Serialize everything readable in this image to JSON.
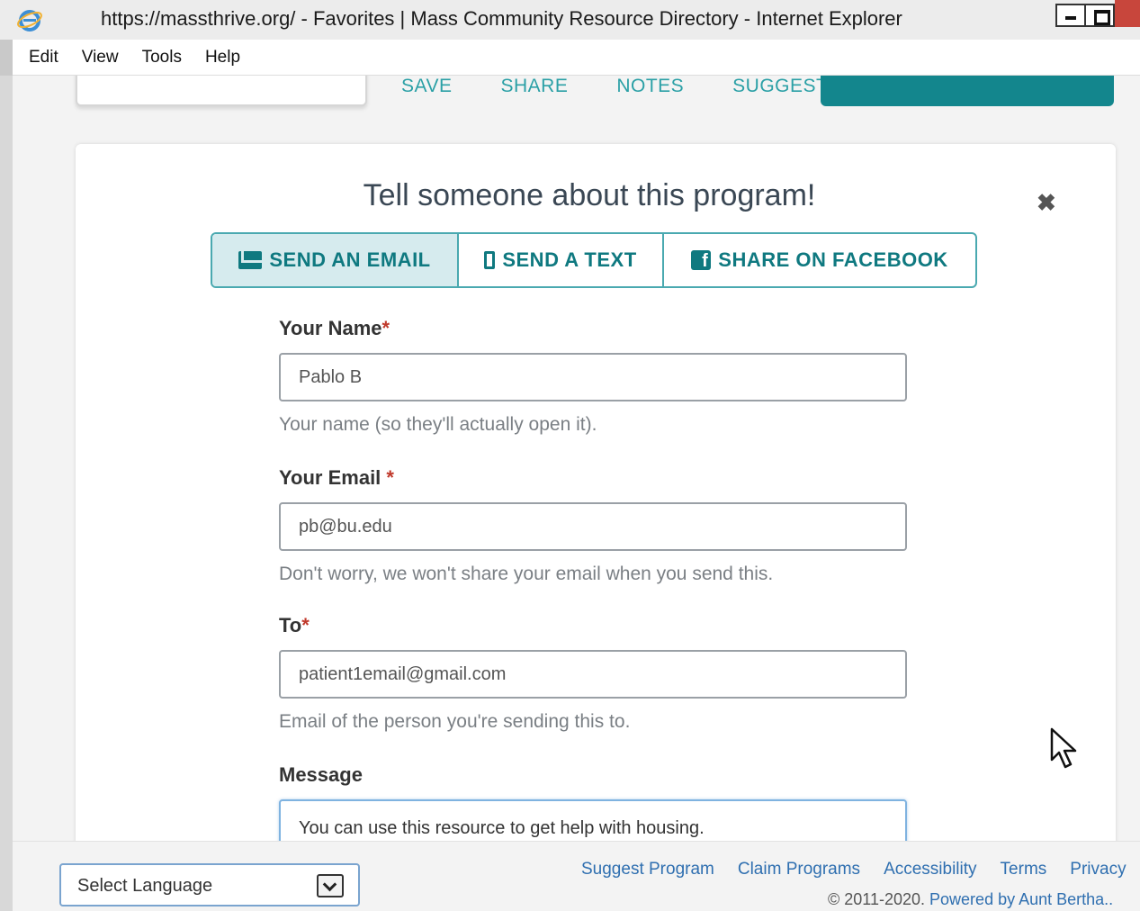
{
  "window": {
    "title": "https://massthrive.org/ - Favorites | Mass Community Resource Directory - Internet Explorer"
  },
  "menu": [
    "Edit",
    "View",
    "Tools",
    "Help"
  ],
  "toolbar": {
    "links": [
      "SAVE",
      "SHARE",
      "NOTES",
      "SUGGEST"
    ]
  },
  "modal": {
    "title": "Tell someone about this program!",
    "close_icon": "close-icon",
    "tabs": [
      {
        "label": "SEND AN EMAIL",
        "icon": "envelope-icon",
        "active": true
      },
      {
        "label": "SEND A TEXT",
        "icon": "phone-icon",
        "active": false
      },
      {
        "label": "SHARE ON FACEBOOK",
        "icon": "facebook-icon",
        "active": false
      }
    ],
    "fields": {
      "name": {
        "label": "Your Name",
        "required_mark": "*",
        "value": "Pablo B",
        "help": "Your name (so they'll actually open it)."
      },
      "email": {
        "label": "Your Email",
        "required_mark": "*",
        "value": "pb@bu.edu",
        "help": "Don't worry, we won't share your email when you send this."
      },
      "to": {
        "label": "To",
        "required_mark": "*",
        "value": "patient1email@gmail.com",
        "help": "Email of the person you're sending this to."
      },
      "message": {
        "label": "Message",
        "value": "You can use this resource to get help with housing."
      }
    }
  },
  "footer": {
    "language_select": "Select Language",
    "links": [
      "Suggest Program",
      "Claim Programs",
      "Accessibility",
      "Terms",
      "Privacy"
    ],
    "copyright_prefix": "© 2011-2020.",
    "powered_by": "Powered by Aunt Bertha.."
  },
  "colors": {
    "accent_teal": "#13868d",
    "link_blue": "#2f6fb0",
    "required_red": "#c0392b"
  }
}
